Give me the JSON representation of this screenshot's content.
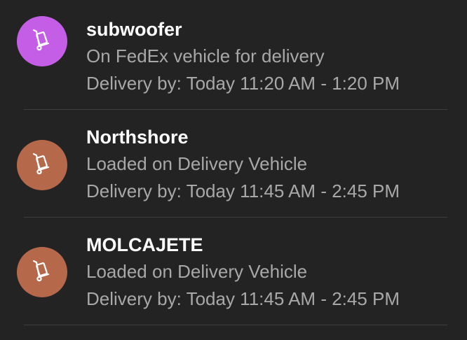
{
  "deliveries": [
    {
      "title": "subwoofer",
      "status": "On FedEx vehicle for delivery",
      "eta": "Delivery by: Today 11:20 AM - 1:20 PM",
      "avatar_color": "#c55ee6",
      "icon": "hand-truck-icon"
    },
    {
      "title": "Northshore",
      "status": "Loaded on Delivery Vehicle",
      "eta": "Delivery by: Today 11:45 AM - 2:45 PM",
      "avatar_color": "#b5694a",
      "icon": "hand-truck-icon"
    },
    {
      "title": "MOLCAJETE",
      "status": "Loaded on Delivery Vehicle",
      "eta": "Delivery by: Today 11:45 AM - 2:45 PM",
      "avatar_color": "#b5694a",
      "icon": "hand-truck-icon"
    }
  ]
}
